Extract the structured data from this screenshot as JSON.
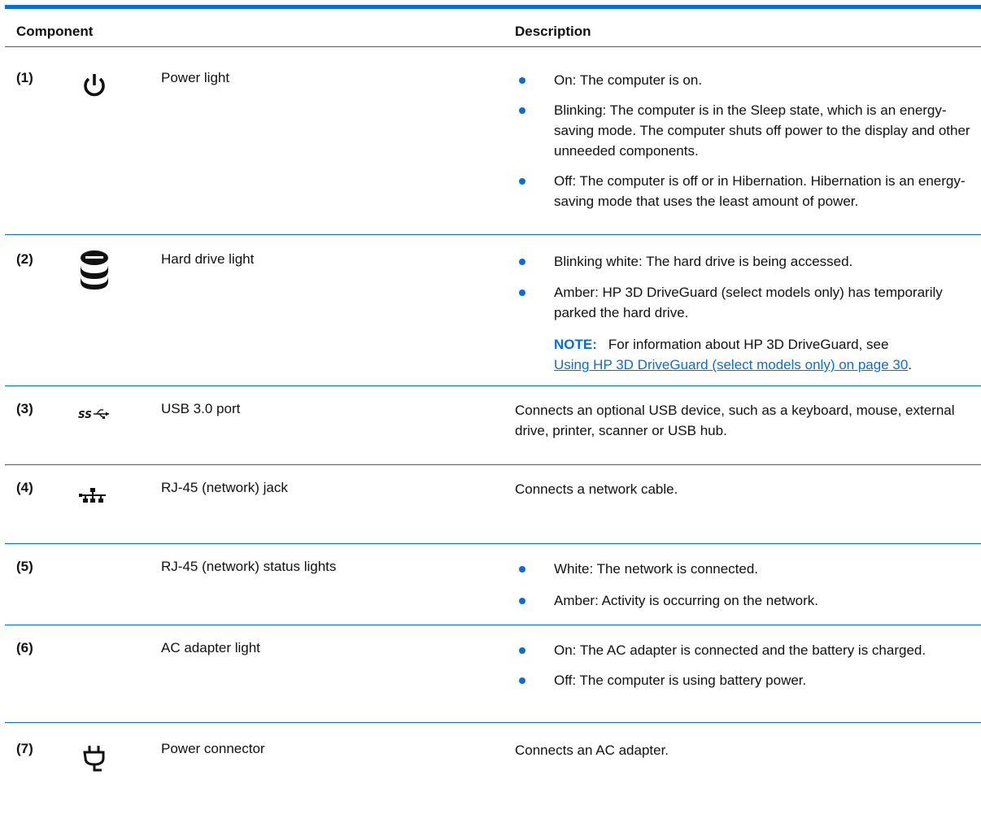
{
  "colors": {
    "accent": "#0a6dd6",
    "text": "#111111"
  },
  "header": {
    "component": "Component",
    "description": "Description"
  },
  "rows": [
    {
      "num": "(1)",
      "icon": "power-icon",
      "name": "Power light",
      "bullets": [
        "On: The computer is on.",
        "Blinking: The computer is in the Sleep state, which is an energy-saving mode. The computer shuts off power to the display and other unneeded components.",
        "Off: The computer is off or in Hibernation. Hibernation is an energy-saving mode that uses the least amount of power."
      ]
    },
    {
      "num": "(2)",
      "icon": "hard-drive-icon",
      "name": "Hard drive light",
      "bullets": [
        "Blinking white: The hard drive is being accessed.",
        "Amber: HP 3D DriveGuard (select models only) has temporarily parked the hard drive."
      ],
      "note": {
        "label": "NOTE:",
        "text": "For information about HP 3D DriveGuard, see",
        "link": "Using HP 3D DriveGuard (select models only) on page 30",
        "end": "."
      }
    },
    {
      "num": "(3)",
      "icon": "usb-superspeed-icon",
      "name": "USB 3.0 port",
      "text": "Connects an optional USB device, such as a keyboard, mouse, external drive, printer, scanner or USB hub."
    },
    {
      "num": "(4)",
      "icon": "network-icon",
      "name": "RJ-45 (network) jack",
      "text": "Connects a network cable."
    },
    {
      "num": "(5)",
      "name": "RJ-45 (network) status lights",
      "bullets": [
        "White: The network is connected.",
        "Amber: Activity is occurring on the network."
      ]
    },
    {
      "num": "(6)",
      "name": "AC adapter light",
      "bullets": [
        "On: The AC adapter is connected and the battery is charged.",
        "Off: The computer is using battery power."
      ]
    },
    {
      "num": "(7)",
      "icon": "power-connector-icon",
      "name": "Power connector",
      "text": "Connects an AC adapter."
    }
  ]
}
